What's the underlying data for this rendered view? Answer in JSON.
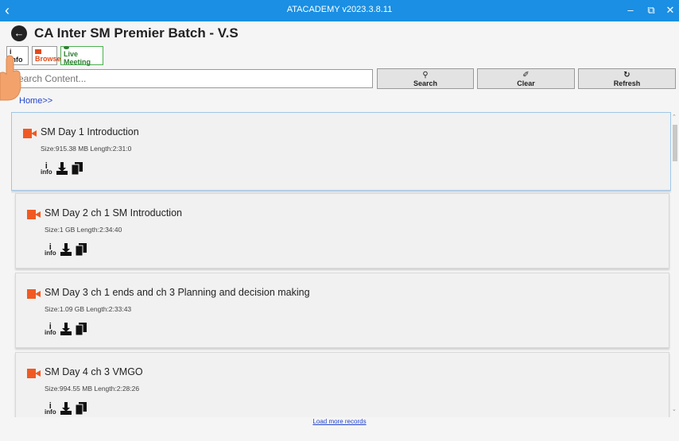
{
  "window": {
    "title": "ATACADEMY v2023.3.8.11",
    "back_glyph": "‹",
    "minimize_glyph": "‒",
    "restore_glyph": "⧉",
    "close_glyph": "✕"
  },
  "header": {
    "title": "CA Inter SM Premier Batch - V.S"
  },
  "toolbar": {
    "info_icon": "i",
    "info_label": "info",
    "browse_label": "Browse",
    "live_label": "Live Meeting"
  },
  "search": {
    "placeholder": "Search Content...",
    "value": "",
    "search_label": "Search",
    "clear_label": "Clear",
    "refresh_label": "Refresh"
  },
  "breadcrumb": "Home>>",
  "items": [
    {
      "title": "SM Day 1 Introduction",
      "meta": "Size:915.38 MB  Length:2:31:0",
      "info_label": "info"
    },
    {
      "title": "SM Day 2 ch 1 SM Introduction",
      "meta": "Size:1 GB  Length:2:34:40",
      "info_label": "info"
    },
    {
      "title": "SM Day 3 ch 1 ends and ch 3 Planning and decision making",
      "meta": "Size:1.09 GB  Length:2:33:43",
      "info_label": "info"
    },
    {
      "title": "SM Day 4 ch 3 VMGO",
      "meta": "Size:994.55 MB  Length:2:28:26",
      "info_label": "info"
    }
  ],
  "load_more": "Load more records",
  "colors": {
    "titlebar": "#1a8fe3",
    "accent_video": "#f05a22",
    "link": "#2244cc"
  },
  "icons": [
    "back-icon",
    "video-icon",
    "info-icon",
    "download-icon",
    "copy-icon",
    "search-icon",
    "clear-icon",
    "refresh-icon"
  ]
}
